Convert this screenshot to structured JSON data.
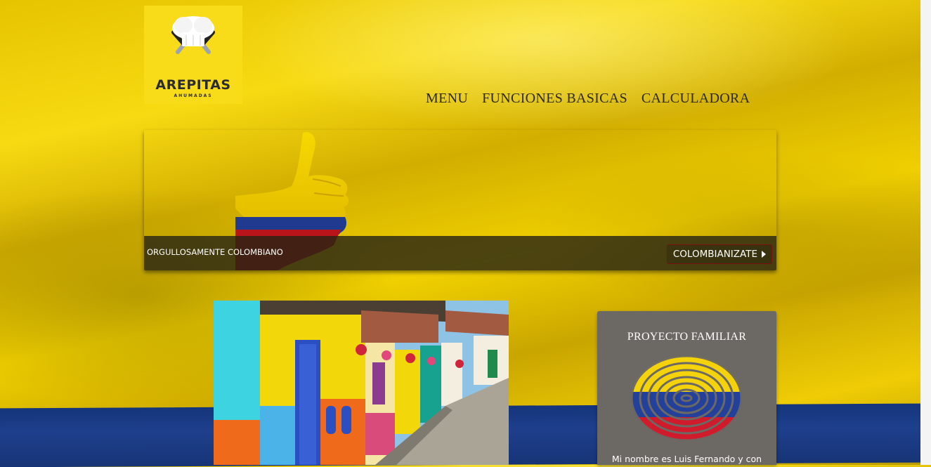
{
  "logo": {
    "title": "AREPITAS",
    "subtitle": "AHUMADAS",
    "icon": "chef-hat-icon"
  },
  "nav": {
    "items": [
      "MENU",
      "FUNCIONES BASICAS",
      "CALCULADORA"
    ]
  },
  "banner": {
    "caption": "ORGULLOSAMENTE COLOMBIANO",
    "cta_label": "COLOMBIANIZATE",
    "cta_icon": "play-arrow-icon"
  },
  "card": {
    "heading": "PROYECTO FAMILIAR",
    "body": "Mi nombre es Luis Fernando y con",
    "icon": "colombia-fingerprint-icon"
  },
  "colors": {
    "flag_yellow": "#f2d000",
    "flag_blue": "#1e3f8c",
    "flag_red": "#c8102e",
    "card_bg": "#6c6864",
    "caption_bg": "#282414"
  }
}
